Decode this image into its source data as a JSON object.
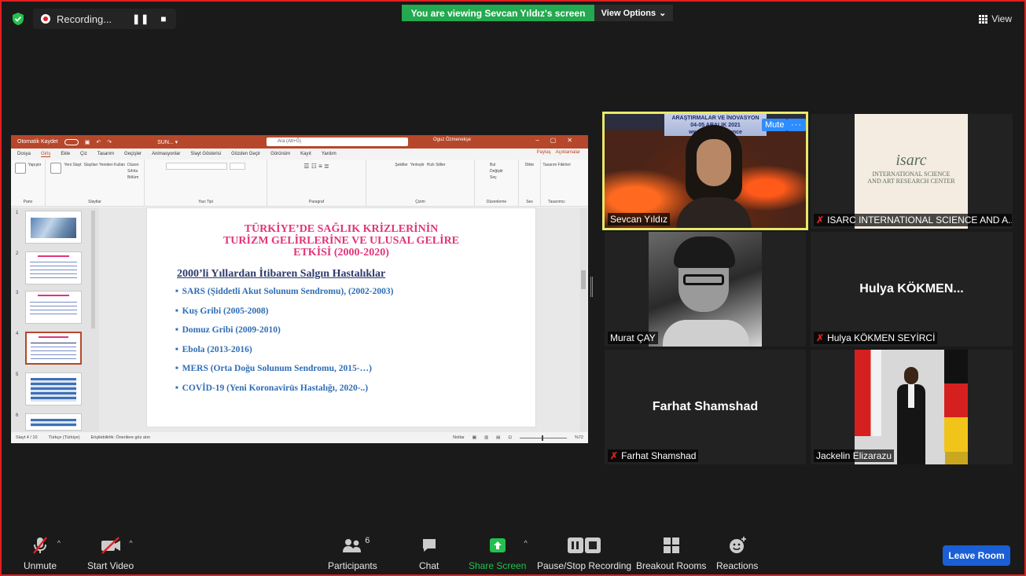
{
  "top_bar": {
    "recording_label": "Recording...",
    "viewing_banner": "You are viewing Sevcan Yıldız's screen",
    "view_options_label": "View Options",
    "view_label": "View"
  },
  "powerpoint": {
    "autosave_label": "Otomatik Kaydet",
    "file_name": "SUN... ▾",
    "search_placeholder": "Ara (Alt+Ğ)",
    "user_name": "Oguz Özmenekşe",
    "tabs": [
      "Dosya",
      "Giriş",
      "Ekle",
      "Çiz",
      "Tasarım",
      "Geçişler",
      "Animasyonlar",
      "Slayt Gösterisi",
      "Gözden Geçir",
      "Görünüm",
      "Kayıt",
      "Yardım"
    ],
    "share_label": "Paylaş",
    "comments_label": "Açıklamalar",
    "ribbon_groups": [
      "Pano",
      "Slaytlar",
      "Yazı Tipi",
      "Paragraf",
      "Çizim",
      "Düzenleme",
      "Ses",
      "Tasarımcı"
    ],
    "ribbon_labels": {
      "paste": "Yapıştır",
      "new_slide": "Yeni Slayt",
      "reuse": "Slaytları Yeniden Kullan",
      "layout": "Düzen",
      "reset": "Sıfırla",
      "section": "Bölüm",
      "shapes": "Şekiller",
      "arrange": "Yerleştir",
      "quick_styles": "Hızlı Stiller",
      "find": "Bul",
      "replace": "Değiştir",
      "select": "Seç",
      "dictate": "Dikte",
      "designer": "Tasarım Fikirleri"
    },
    "thumb_numbers": [
      "1",
      "2",
      "3",
      "4",
      "5",
      "6"
    ],
    "status": {
      "slide_info": "Slayt 4 / 10",
      "language": "Türkçe (Türkiye)",
      "accessibility": "Erişilebilirlik: Önerilere göz atın",
      "notes": "Notlar",
      "zoom": "%72"
    }
  },
  "slide": {
    "title_line1": "TÜRKİYE’DE SAĞLIK KRİZLERİNİN",
    "title_line2": "TURİZM GELİRLERİNE VE ULUSAL GELİRE",
    "title_line3": "ETKİSİ (2000-2020)",
    "subtitle": "2000’li Yıllardan İtibaren Salgın Hastalıklar",
    "bullets": [
      "SARS (Şiddetli Akut Solunum Sendromu), (2002-2003)",
      "Kuş Gribi (2005-2008)",
      "Domuz Gribi (2009-2010)",
      "Ebola (2013-2016)",
      "MERS (Orta Doğu Solunum Sendromu, 2015-…)",
      "COVİD-19 (Yeni Koronavirüs Hastalığı, 2020-..)"
    ]
  },
  "participants": {
    "tile1": {
      "name": "Sevcan Yıldız",
      "mute_label": "Mute",
      "more_label": "···",
      "banner_line1": "ARAŞTIRMALAR VE İNOVASYON",
      "banner_line2": "04-05 ARALIK 2021",
      "banner_line3": "www.isarconference"
    },
    "tile2": {
      "name": "ISARC INTERNATIONAL SCIENCE AND A...",
      "logo_script": "isarc",
      "logo_line1": "INTERNATIONAL SCIENCE",
      "logo_line2": "AND ART RESEARCH CENTER"
    },
    "tile3": {
      "name": "Murat ÇAY"
    },
    "tile4": {
      "display_name": "Hulya  KÖKMEN...",
      "name": "Hulya KÖKMEN SEYİRCİ"
    },
    "tile5": {
      "display_name": "Farhat Shamshad",
      "name": "Farhat Shamshad"
    },
    "tile6": {
      "name": "Jackelin Elizarazu"
    }
  },
  "toolbar": {
    "unmute": "Unmute",
    "start_video": "Start Video",
    "participants": "Participants",
    "participants_count": "6",
    "chat": "Chat",
    "share_screen": "Share Screen",
    "pause_recording": "Pause/Stop Recording",
    "breakout_rooms": "Breakout Rooms",
    "reactions": "Reactions",
    "leave_room": "Leave Room"
  },
  "colors": {
    "banner_green": "#23a94f",
    "leave_blue": "#1a5fd6",
    "active_speaker": "#e8e86a",
    "slide_title_pink": "#e0357a",
    "bullet_blue": "#2f6db5",
    "frame_red": "#e02020"
  }
}
